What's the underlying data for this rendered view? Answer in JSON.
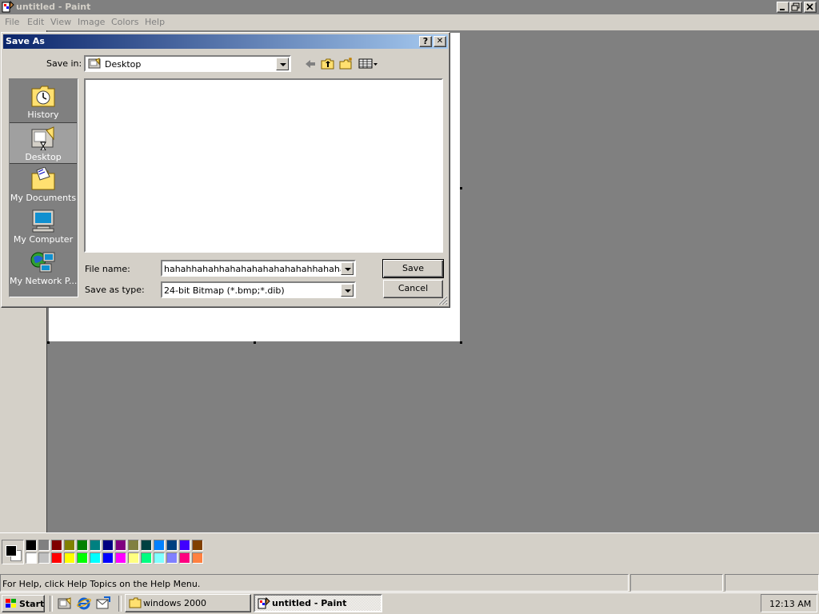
{
  "app": {
    "title": "untitled - Paint",
    "menu": [
      "File",
      "Edit",
      "View",
      "Image",
      "Colors",
      "Help"
    ],
    "status_text": "For Help, click Help Topics on the Help Menu."
  },
  "dialog": {
    "title": "Save As",
    "help_label": "?",
    "close_label": "✕",
    "save_in_label": "Save in:",
    "save_in_value": "Desktop",
    "places": [
      "History",
      "Desktop",
      "My Documents",
      "My Computer",
      "My Network P..."
    ],
    "file_name_label": "File name:",
    "file_name_value": "hahahhahahhahahahahahahahahhahahahaha",
    "save_as_type_label": "Save as type:",
    "save_as_type_value": "24-bit Bitmap (*.bmp;*.dib)",
    "save_button": "Save",
    "cancel_button": "Cancel"
  },
  "palette": {
    "primary": "#000000",
    "secondary": "#ffffff",
    "row1": [
      "#000000",
      "#808080",
      "#800000",
      "#808000",
      "#008000",
      "#008080",
      "#000080",
      "#800080",
      "#808040",
      "#004040",
      "#0080ff",
      "#004080",
      "#4000ff",
      "#804000"
    ],
    "row2": [
      "#ffffff",
      "#c0c0c0",
      "#ff0000",
      "#ffff00",
      "#00ff00",
      "#00ffff",
      "#0000ff",
      "#ff00ff",
      "#ffff80",
      "#00ff80",
      "#80ffff",
      "#8080ff",
      "#ff0080",
      "#ff8040"
    ]
  },
  "taskbar": {
    "start_label": "Start",
    "tasks": [
      "windows 2000",
      "untitled - Paint"
    ],
    "clock": "12:13 AM"
  }
}
